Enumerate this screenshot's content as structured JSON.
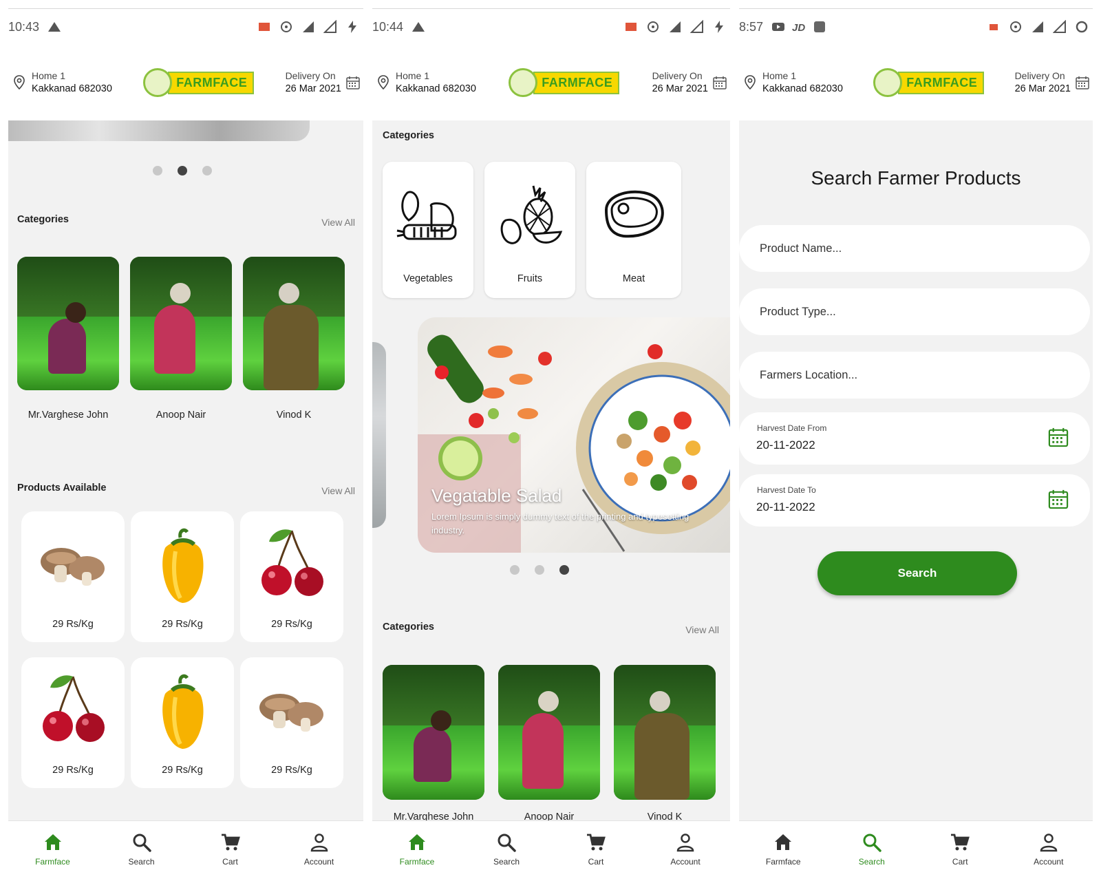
{
  "colors": {
    "accent": "#2e8b1e",
    "logo_yellow": "#f7d800",
    "background": "#f2f2f2"
  },
  "screens": [
    {
      "status": {
        "time": "10:43"
      },
      "header": {
        "location_line1": "Home 1",
        "location_line2": "Kakkanad 682030",
        "logo_text": "FARMFACE",
        "delivery_line1": "Delivery On",
        "delivery_line2": "26 Mar 2021"
      },
      "categories_title": "Categories",
      "categories_view_all": "View All",
      "farmers": [
        "Mr.Varghese John",
        "Anoop Nair",
        "Vinod K"
      ],
      "products_title": "Products Available",
      "products_view_all": "View All",
      "products": [
        "29 Rs/Kg",
        "29 Rs/Kg",
        "29 Rs/Kg",
        "29 Rs/Kg",
        "29 Rs/Kg",
        "29 Rs/Kg"
      ],
      "product_icons": [
        "mushroom-icon",
        "bell-pepper-icon",
        "cherry-icon",
        "cherry-icon",
        "bell-pepper-icon",
        "mushroom-icon"
      ],
      "carousel_active": 2,
      "nav": [
        "Farmface",
        "Search",
        "Cart",
        "Account"
      ],
      "nav_active": "Farmface"
    },
    {
      "status": {
        "time": "10:44"
      },
      "header": {
        "location_line1": "Home 1",
        "location_line2": "Kakkanad 682030",
        "logo_text": "FARMFACE",
        "delivery_line1": "Delivery On",
        "delivery_line2": "26 Mar 2021"
      },
      "top_categories_title": "Categories",
      "category_tiles": [
        "Vegetables",
        "Fruits",
        "Meat"
      ],
      "banner": {
        "title": "Vegatable Salad",
        "text": "Lorem Ipsum is simply dummy text of the printing and typesetting industry."
      },
      "carousel_active": 3,
      "categories_title": "Categories",
      "categories_view_all": "View All",
      "farmers": [
        "Mr.Varghese John",
        "Anoop Nair",
        "Vinod K"
      ],
      "nav": [
        "Farmface",
        "Search",
        "Cart",
        "Account"
      ],
      "nav_active": "Farmface"
    },
    {
      "status": {
        "time": "8:57"
      },
      "header": {
        "location_line1": "Home 1",
        "location_line2": "Kakkanad 682030",
        "logo_text": "FARMFACE",
        "delivery_line1": "Delivery On",
        "delivery_line2": "26 Mar 2021"
      },
      "search": {
        "title": "Search Farmer Products",
        "product_name_placeholder": "Product Name...",
        "product_type_placeholder": "Product Type...",
        "farmers_location_placeholder": "Farmers Location...",
        "harvest_from_label": "Harvest Date From",
        "harvest_from_value": "20-11-2022",
        "harvest_to_label": "Harvest Date To",
        "harvest_to_value": "20-11-2022",
        "button_label": "Search"
      },
      "nav": [
        "Farmface",
        "Search",
        "Cart",
        "Account"
      ],
      "nav_active": "Search"
    }
  ]
}
